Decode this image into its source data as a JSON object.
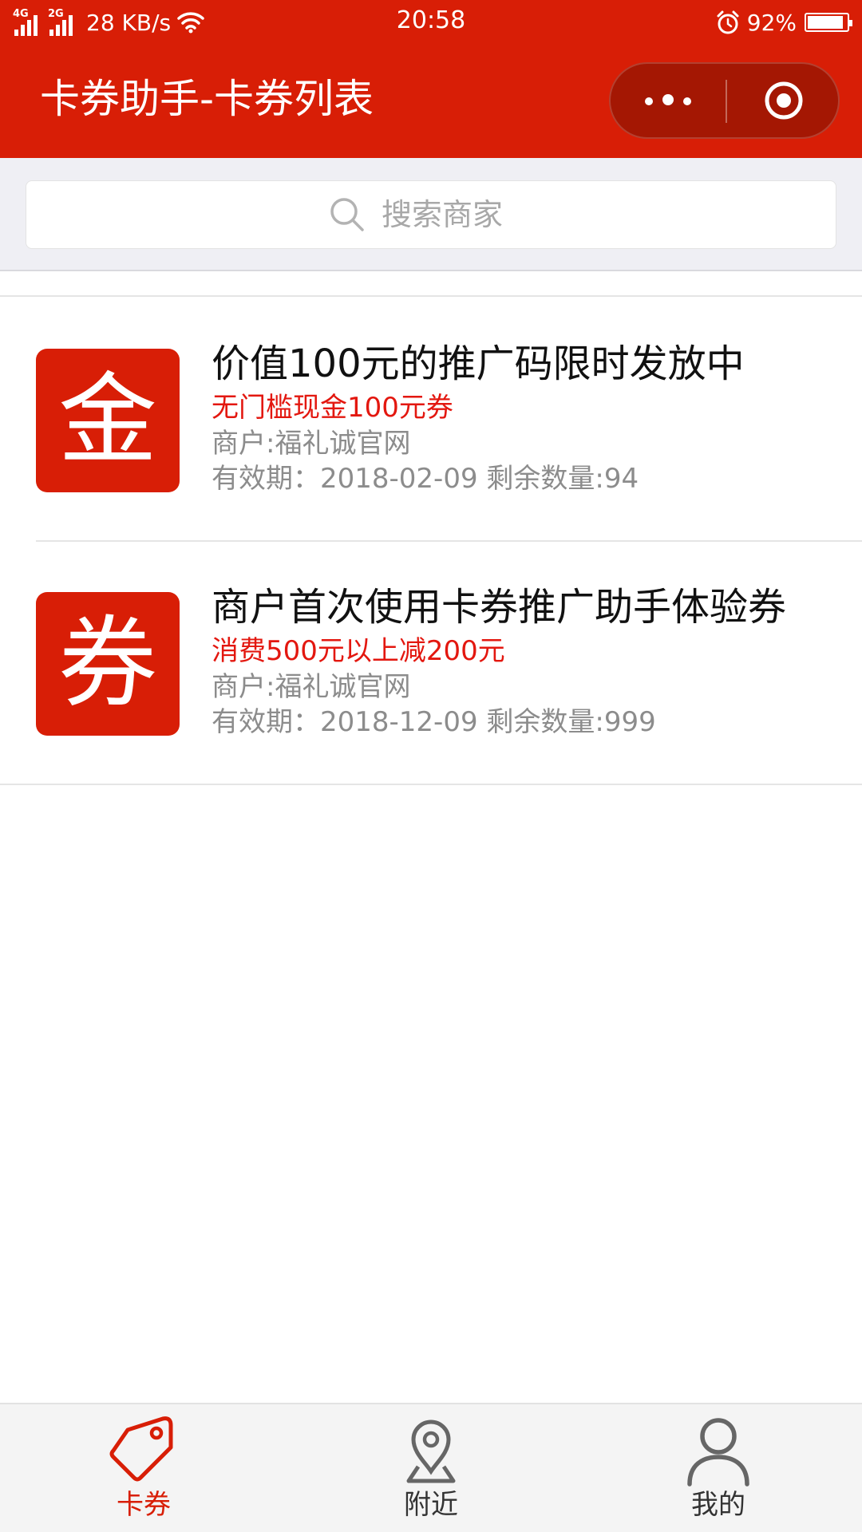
{
  "status_bar": {
    "network_1": "4G",
    "network_2": "2G",
    "speed": "28 KB/s",
    "time": "20:58",
    "battery": "92%",
    "battery_level": 0.92
  },
  "header": {
    "title": "卡券助手-卡券列表",
    "more_icon": "more-dots-icon",
    "close_icon": "target-close-icon",
    "brand_color": "#d81e06"
  },
  "search": {
    "placeholder": "搜索商家",
    "icon": "search-icon"
  },
  "coupons": [
    {
      "icon_char": "金",
      "title": "价值100元的推广码限时发放中",
      "desc": "无门槛现金100元券",
      "merchant": "商户:福礼诚官网",
      "validity": "有效期：2018-02-09 剩余数量:94"
    },
    {
      "icon_char": "券",
      "title": "商户首次使用卡券推广助手体验券",
      "desc": "消费500元以上减200元",
      "merchant": "商户:福礼诚官网",
      "validity": "有效期：2018-12-09 剩余数量:999"
    }
  ],
  "tabbar": {
    "tabs": [
      {
        "label": "卡券",
        "icon": "tag-icon",
        "active": true
      },
      {
        "label": "附近",
        "icon": "location-pin-icon",
        "active": false
      },
      {
        "label": "我的",
        "icon": "user-icon",
        "active": false
      }
    ],
    "active_color": "#d81e06"
  }
}
